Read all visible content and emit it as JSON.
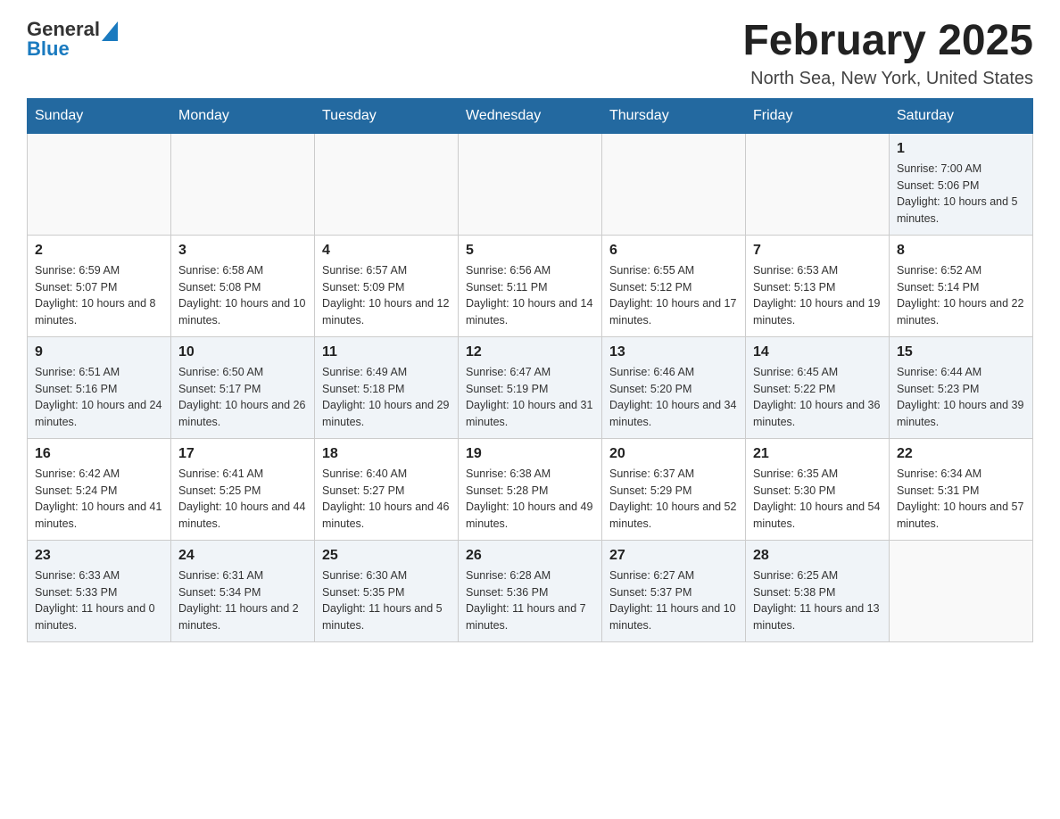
{
  "header": {
    "logo_general": "General",
    "logo_blue": "Blue",
    "month_title": "February 2025",
    "location": "North Sea, New York, United States"
  },
  "days_of_week": [
    "Sunday",
    "Monday",
    "Tuesday",
    "Wednesday",
    "Thursday",
    "Friday",
    "Saturday"
  ],
  "weeks": [
    {
      "days": [
        {
          "number": "",
          "info": ""
        },
        {
          "number": "",
          "info": ""
        },
        {
          "number": "",
          "info": ""
        },
        {
          "number": "",
          "info": ""
        },
        {
          "number": "",
          "info": ""
        },
        {
          "number": "",
          "info": ""
        },
        {
          "number": "1",
          "info": "Sunrise: 7:00 AM\nSunset: 5:06 PM\nDaylight: 10 hours and 5 minutes."
        }
      ]
    },
    {
      "days": [
        {
          "number": "2",
          "info": "Sunrise: 6:59 AM\nSunset: 5:07 PM\nDaylight: 10 hours and 8 minutes."
        },
        {
          "number": "3",
          "info": "Sunrise: 6:58 AM\nSunset: 5:08 PM\nDaylight: 10 hours and 10 minutes."
        },
        {
          "number": "4",
          "info": "Sunrise: 6:57 AM\nSunset: 5:09 PM\nDaylight: 10 hours and 12 minutes."
        },
        {
          "number": "5",
          "info": "Sunrise: 6:56 AM\nSunset: 5:11 PM\nDaylight: 10 hours and 14 minutes."
        },
        {
          "number": "6",
          "info": "Sunrise: 6:55 AM\nSunset: 5:12 PM\nDaylight: 10 hours and 17 minutes."
        },
        {
          "number": "7",
          "info": "Sunrise: 6:53 AM\nSunset: 5:13 PM\nDaylight: 10 hours and 19 minutes."
        },
        {
          "number": "8",
          "info": "Sunrise: 6:52 AM\nSunset: 5:14 PM\nDaylight: 10 hours and 22 minutes."
        }
      ]
    },
    {
      "days": [
        {
          "number": "9",
          "info": "Sunrise: 6:51 AM\nSunset: 5:16 PM\nDaylight: 10 hours and 24 minutes."
        },
        {
          "number": "10",
          "info": "Sunrise: 6:50 AM\nSunset: 5:17 PM\nDaylight: 10 hours and 26 minutes."
        },
        {
          "number": "11",
          "info": "Sunrise: 6:49 AM\nSunset: 5:18 PM\nDaylight: 10 hours and 29 minutes."
        },
        {
          "number": "12",
          "info": "Sunrise: 6:47 AM\nSunset: 5:19 PM\nDaylight: 10 hours and 31 minutes."
        },
        {
          "number": "13",
          "info": "Sunrise: 6:46 AM\nSunset: 5:20 PM\nDaylight: 10 hours and 34 minutes."
        },
        {
          "number": "14",
          "info": "Sunrise: 6:45 AM\nSunset: 5:22 PM\nDaylight: 10 hours and 36 minutes."
        },
        {
          "number": "15",
          "info": "Sunrise: 6:44 AM\nSunset: 5:23 PM\nDaylight: 10 hours and 39 minutes."
        }
      ]
    },
    {
      "days": [
        {
          "number": "16",
          "info": "Sunrise: 6:42 AM\nSunset: 5:24 PM\nDaylight: 10 hours and 41 minutes."
        },
        {
          "number": "17",
          "info": "Sunrise: 6:41 AM\nSunset: 5:25 PM\nDaylight: 10 hours and 44 minutes."
        },
        {
          "number": "18",
          "info": "Sunrise: 6:40 AM\nSunset: 5:27 PM\nDaylight: 10 hours and 46 minutes."
        },
        {
          "number": "19",
          "info": "Sunrise: 6:38 AM\nSunset: 5:28 PM\nDaylight: 10 hours and 49 minutes."
        },
        {
          "number": "20",
          "info": "Sunrise: 6:37 AM\nSunset: 5:29 PM\nDaylight: 10 hours and 52 minutes."
        },
        {
          "number": "21",
          "info": "Sunrise: 6:35 AM\nSunset: 5:30 PM\nDaylight: 10 hours and 54 minutes."
        },
        {
          "number": "22",
          "info": "Sunrise: 6:34 AM\nSunset: 5:31 PM\nDaylight: 10 hours and 57 minutes."
        }
      ]
    },
    {
      "days": [
        {
          "number": "23",
          "info": "Sunrise: 6:33 AM\nSunset: 5:33 PM\nDaylight: 11 hours and 0 minutes."
        },
        {
          "number": "24",
          "info": "Sunrise: 6:31 AM\nSunset: 5:34 PM\nDaylight: 11 hours and 2 minutes."
        },
        {
          "number": "25",
          "info": "Sunrise: 6:30 AM\nSunset: 5:35 PM\nDaylight: 11 hours and 5 minutes."
        },
        {
          "number": "26",
          "info": "Sunrise: 6:28 AM\nSunset: 5:36 PM\nDaylight: 11 hours and 7 minutes."
        },
        {
          "number": "27",
          "info": "Sunrise: 6:27 AM\nSunset: 5:37 PM\nDaylight: 11 hours and 10 minutes."
        },
        {
          "number": "28",
          "info": "Sunrise: 6:25 AM\nSunset: 5:38 PM\nDaylight: 11 hours and 13 minutes."
        },
        {
          "number": "",
          "info": ""
        }
      ]
    }
  ]
}
